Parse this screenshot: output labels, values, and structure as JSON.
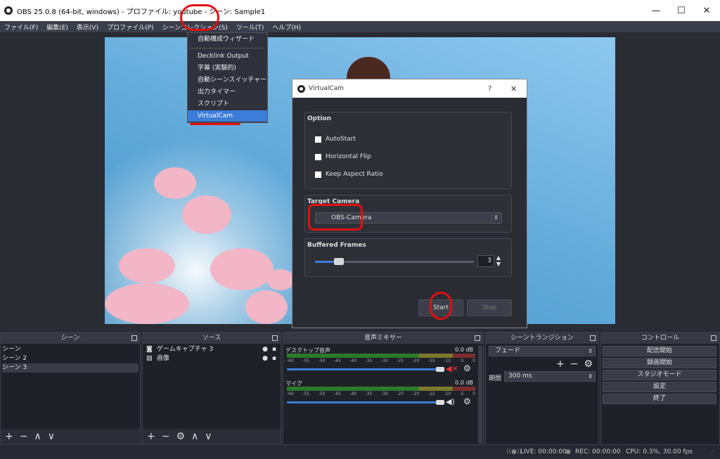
{
  "window": {
    "title": "OBS 25.0.8 (64-bit, windows) - プロファイル: youtube - シーン: Sample1",
    "minimize": "—",
    "maximize": "☐",
    "close": "✕"
  },
  "menu": [
    "ファイル(F)",
    "編集(E)",
    "表示(V)",
    "プロファイル(P)",
    "シーンコレクション(S)",
    "ツール(T)",
    "ヘルプ(H)"
  ],
  "tools_menu": {
    "items": [
      "自動構成ウィザード",
      "Decklink Output",
      "字幕 (実験的)",
      "自動シーンスイッチャー",
      "出力タイマー",
      "スクリプト",
      "VirtualCam"
    ],
    "selected": "VirtualCam"
  },
  "virtualcam": {
    "title": "VirtualCam",
    "help": "?",
    "close": "✕",
    "option_label": "Option",
    "options": [
      "AutoStart",
      "Horizontal Flip",
      "Keep Aspect Ratio"
    ],
    "target_label": "Target Camera",
    "target_value": "OBS-Camera",
    "buffered_label": "Buffered Frames",
    "buffered_value": "3",
    "buffered_fraction": 0.12,
    "start": "Start",
    "stop": "Stop"
  },
  "docks": {
    "scenes": {
      "title": "シーン",
      "items": [
        "シーン",
        "シーン 2",
        "シーン 3"
      ],
      "selected": 2
    },
    "sources": {
      "title": "ソース",
      "items": [
        "ゲームキャプチャ 3",
        "画像"
      ]
    },
    "mixer": {
      "title": "音声ミキサー",
      "ticks": [
        "-60",
        "-55",
        "-50",
        "-45",
        "-40",
        "-35",
        "-30",
        "-25",
        "-20",
        "-15",
        "-10",
        "-5",
        "0"
      ],
      "channels": [
        {
          "name": "デスクトップ音声",
          "db": "0.0 dB",
          "muted": true
        },
        {
          "name": "マイク",
          "db": "0.0 dB",
          "muted": false
        }
      ]
    },
    "transitions": {
      "title": "シーントランジション",
      "transition": "フェード",
      "duration_label": "期間",
      "duration": "300 ms"
    },
    "controls": {
      "title": "コントロール",
      "buttons": [
        "配信開始",
        "録画開始",
        "スタジオモード",
        "設定",
        "終了"
      ]
    }
  },
  "status": {
    "live": "LIVE: 00:00:00",
    "rec": "REC: 00:00:00",
    "cpu": "CPU: 0.3%, 30.00 fps"
  },
  "colors": {
    "accent": "#3c7dd9",
    "annotation": "#e01010"
  }
}
